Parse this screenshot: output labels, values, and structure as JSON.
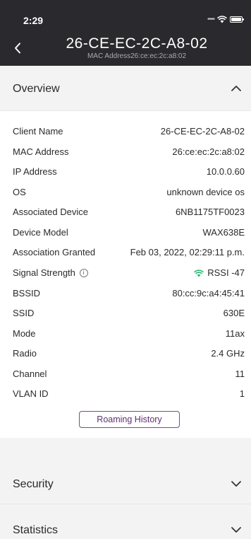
{
  "status_bar": {
    "time": "2:29"
  },
  "header": {
    "title": "26-CE-EC-2C-A8-02",
    "subtitle": "MAC Address26:ce:ec:2c:a8:02"
  },
  "sections": {
    "overview": "Overview",
    "security": "Security",
    "statistics": "Statistics"
  },
  "details": [
    {
      "label": "Client Name",
      "value": "26-CE-EC-2C-A8-02"
    },
    {
      "label": "MAC Address",
      "value": "26:ce:ec:2c:a8:02"
    },
    {
      "label": "IP Address",
      "value": "10.0.0.60"
    },
    {
      "label": "OS",
      "value": "unknown device os"
    },
    {
      "label": "Associated Device",
      "value": "6NB1175TF0023"
    },
    {
      "label": "Device Model",
      "value": "WAX638E"
    },
    {
      "label": "Association Granted",
      "value": "Feb 03, 2022, 02:29:11 p.m."
    },
    {
      "label": "Signal Strength",
      "value": "RSSI -47"
    },
    {
      "label": "BSSID",
      "value": "80:cc:9c:a4:45:41"
    },
    {
      "label": "SSID",
      "value": "630E"
    },
    {
      "label": "Mode",
      "value": "11ax"
    },
    {
      "label": "Radio",
      "value": "2.4 GHz"
    },
    {
      "label": "Channel",
      "value": "11"
    },
    {
      "label": "VLAN ID",
      "value": "1"
    }
  ],
  "roaming_button": "Roaming History",
  "colors": {
    "header_bg": "#2a2a2e",
    "accent": "#5e2f70",
    "wifi": "#2bb673",
    "section_bg": "#f3f3f3"
  }
}
